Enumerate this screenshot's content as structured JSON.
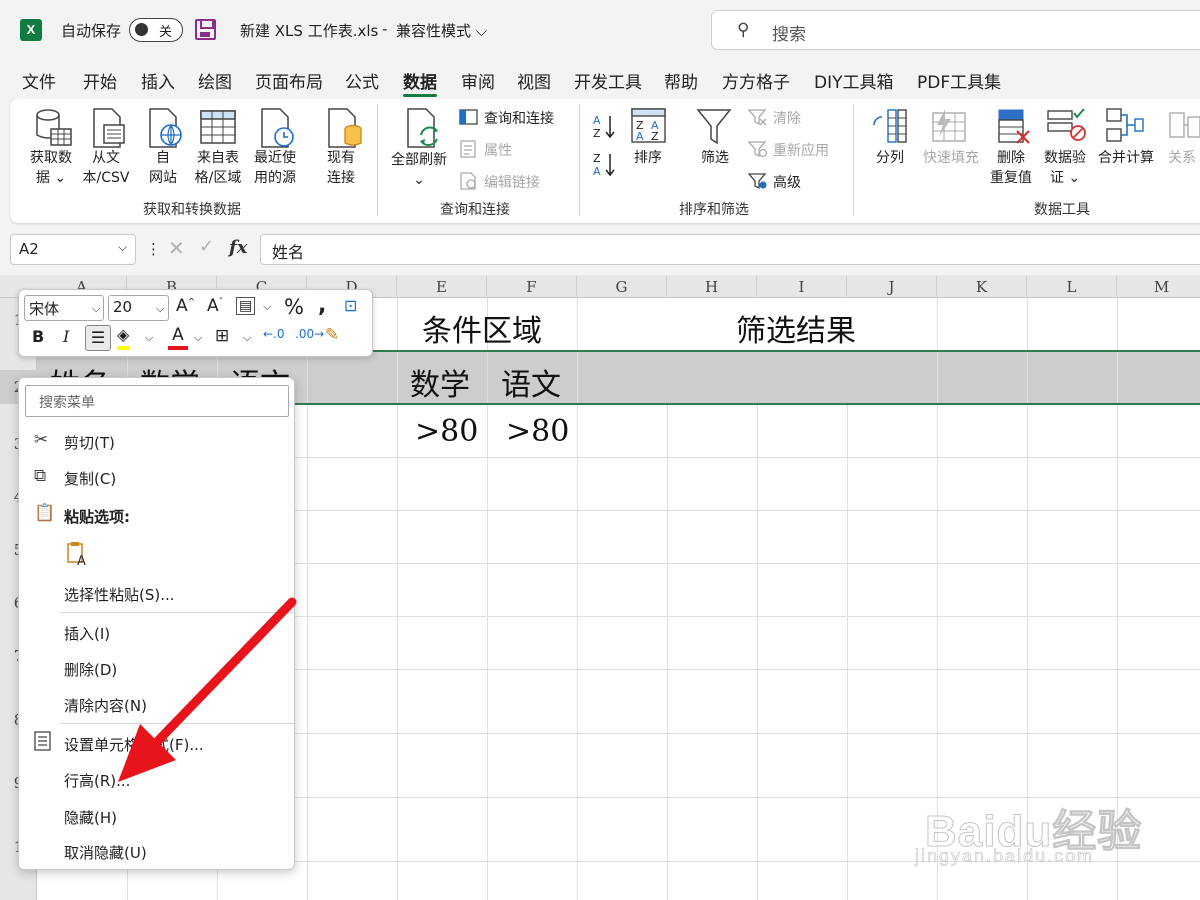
{
  "titlebar": {
    "app_logo": "X",
    "autosave_label": "自动保存",
    "autosave_state": "关",
    "doc_title": "新建 XLS 工作表.xls",
    "separator": "-",
    "mode": "兼容性模式",
    "search_placeholder": "搜索"
  },
  "tabs": [
    "文件",
    "开始",
    "插入",
    "绘图",
    "页面布局",
    "公式",
    "数据",
    "审阅",
    "视图",
    "开发工具",
    "帮助",
    "方方格子",
    "DIY工具箱",
    "PDF工具集"
  ],
  "active_tab": "数据",
  "ribbon": {
    "groups": [
      "获取和转换数据",
      "查询和连接",
      "排序和筛选",
      "数据工具"
    ],
    "get_data": [
      "获取数",
      "据"
    ],
    "from_csv": [
      "从文",
      "本/CSV"
    ],
    "from_web": [
      "自",
      "网站"
    ],
    "from_table": [
      "来自表",
      "格/区域"
    ],
    "recent": [
      "最近使",
      "用的源"
    ],
    "existing": [
      "现有",
      "连接"
    ],
    "refresh_all": "全部刷新",
    "queries": "查询和连接",
    "properties": "属性",
    "edit_links": "编辑链接",
    "sort": "排序",
    "filter": "筛选",
    "clear": "清除",
    "reapply": "重新应用",
    "advanced": "高级",
    "split": "分列",
    "flash_fill": "快速填充",
    "remove_dup": [
      "删除",
      "重复值"
    ],
    "validation": [
      "数据验",
      "证"
    ],
    "consolidate": "合并计算",
    "relationships": "关系"
  },
  "formula_bar": {
    "cell_ref": "A2",
    "content": "姓名"
  },
  "columns": [
    "A",
    "B",
    "C",
    "D",
    "E",
    "F",
    "G",
    "H",
    "I",
    "J",
    "K",
    "L",
    "M"
  ],
  "rows": [
    "1",
    "2",
    "3",
    "4",
    "5",
    "6",
    "7",
    "8",
    "9",
    "1"
  ],
  "cells": {
    "e1": "条件区域",
    "h1": "筛选结果",
    "a2": "姓名",
    "b2": "数学",
    "c2": "语文",
    "e2": "数学",
    "f2": "语文",
    "e3": ">80",
    "f3": ">80"
  },
  "mini_toolbar": {
    "font": "宋体",
    "size": "20"
  },
  "context_menu": {
    "search_placeholder": "搜索菜单",
    "items": [
      "剪切(T)",
      "复制(C)",
      "粘贴选项:",
      "选择性粘贴(S)...",
      "插入(I)",
      "删除(D)",
      "清除内容(N)",
      "设置单元格格式(F)...",
      "行高(R)...",
      "隐藏(H)",
      "取消隐藏(U)"
    ]
  },
  "watermark": {
    "main": "Baidu经验",
    "sub": "jingyan.baidu.com"
  },
  "colors": {
    "excel_green": "#107c41",
    "annotation_red": "#e8141b",
    "selection_band": "#cdcdcd"
  }
}
